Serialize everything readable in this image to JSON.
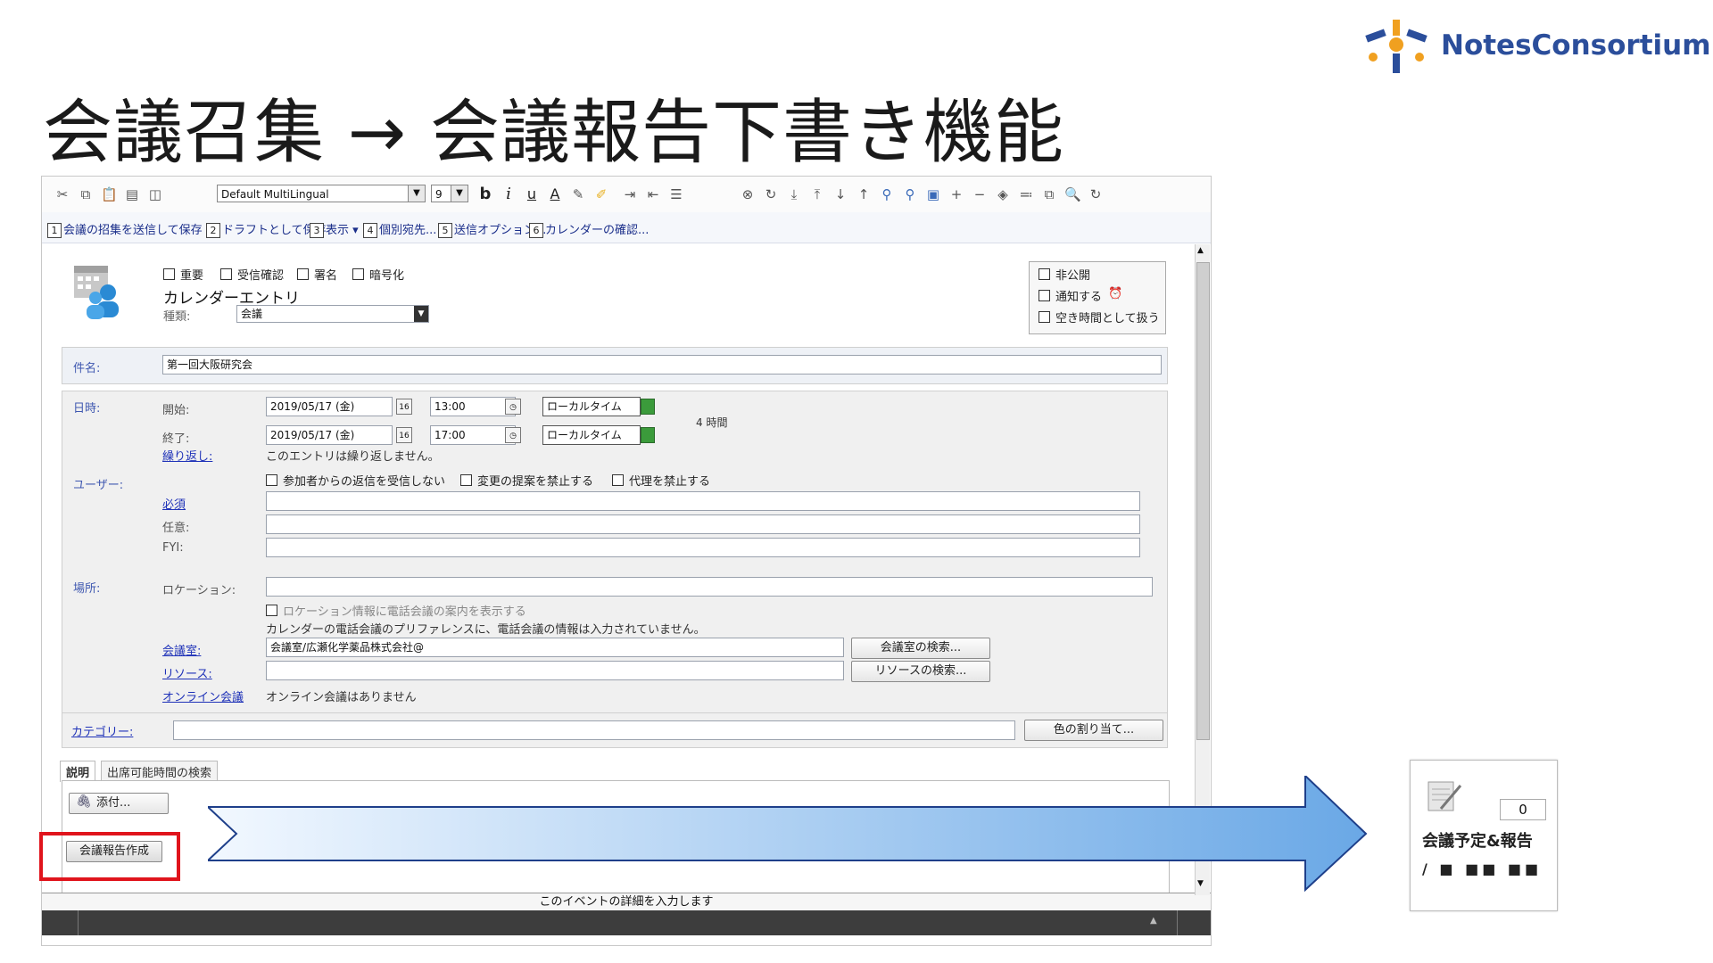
{
  "logo": {
    "text_part1": "Notes",
    "text_part2": "Consortium"
  },
  "slide": {
    "title": "会議召集 → 会議報告下書き機能"
  },
  "toolbar": {
    "font_select": "Default MultiLingual",
    "size_select": "9",
    "bold": "b",
    "italic": "i",
    "underline": "u",
    "font_color": "A"
  },
  "action_bar": {
    "items": [
      {
        "num": "1",
        "label": "会議の招集を送信して保存"
      },
      {
        "num": "2",
        "label": "ドラフトとして保存"
      },
      {
        "num": "3",
        "label": "表示 ▾"
      },
      {
        "num": "4",
        "label": "個別宛先..."
      },
      {
        "num": "5",
        "label": "送信オプション..."
      },
      {
        "num": "6",
        "label": "カレンダーの確認..."
      }
    ]
  },
  "header": {
    "options": [
      "重要",
      "受信確認",
      "署名",
      "暗号化"
    ],
    "entry_title": "カレンダーエントリ",
    "type_label": "種類:",
    "type_value": "会議",
    "privacy": [
      "非公開",
      "通知する",
      "空き時間として扱う"
    ]
  },
  "subject": {
    "label": "件名:",
    "value": "第一回大阪研究会"
  },
  "datetime": {
    "section_label": "日時:",
    "start_label": "開始:",
    "start_date": "2019/05/17 (金)",
    "start_time": "13:00",
    "start_tz": "ローカルタイム",
    "end_label": "終了:",
    "end_date": "2019/05/17 (金)",
    "end_time": "17:00",
    "end_tz": "ローカルタイム",
    "duration": "4 時間",
    "repeat_link": "繰り返し:",
    "repeat_text": "このエントリは繰り返しません。"
  },
  "users": {
    "section_label": "ユーザー:",
    "options": [
      "参加者からの返信を受信しない",
      "変更の提案を禁止する",
      "代理を禁止する"
    ],
    "required_label": "必須",
    "optional_label": "任意:",
    "fyi_label": "FYI:"
  },
  "place": {
    "section_label": "場所:",
    "location_label": "ロケーション:",
    "phone_option": "ロケーション情報に電話会議の案内を表示する",
    "phone_note": "カレンダーの電話会議のプリファレンスに、電話会議の情報は入力されていません。",
    "room_link": "会議室:",
    "room_value": "会議室/広瀬化学薬品株式会社@",
    "room_button": "会議室の検索...",
    "resource_link": "リソース:",
    "resource_button": "リソースの検索...",
    "online_link": "オンライン会議",
    "online_text": "オンライン会議はありません"
  },
  "category": {
    "link": "カテゴリー:",
    "button": "色の割り当て..."
  },
  "tabs": [
    {
      "label": "説明"
    },
    {
      "label": "出席可能時間の検索"
    }
  ],
  "description": {
    "attach_button": "添付...",
    "report_button": "会議報告作成",
    "status_hint": "このイベントの詳細を入力します"
  },
  "widget": {
    "count": "0",
    "label": "会議予定&報告",
    "sub": "/ ■ ■■ ■■"
  },
  "colors": {
    "arrow_start": "#f2f8ff",
    "arrow_end": "#6aa8e6",
    "highlight": "#e0141c",
    "link": "#1f32b8"
  }
}
